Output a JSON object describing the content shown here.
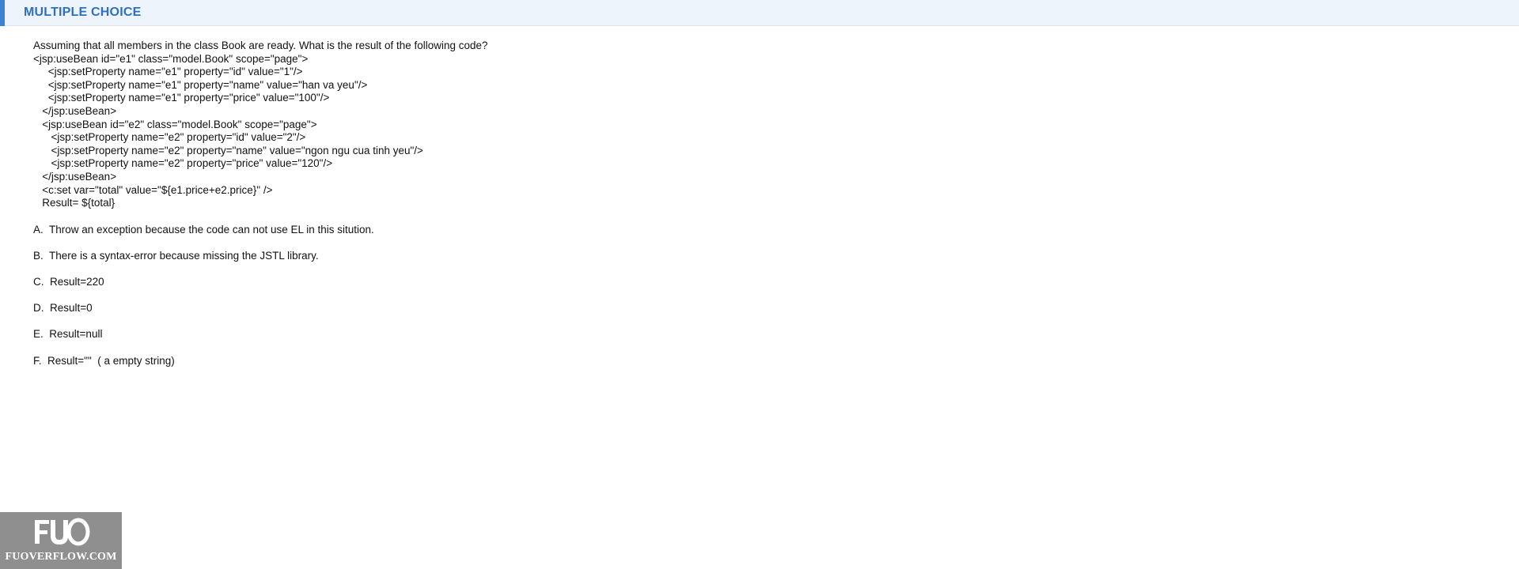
{
  "header": {
    "title": "MULTIPLE CHOICE"
  },
  "question": {
    "lines": [
      "Assuming that all members in the class Book are ready. What is the result of the following code?",
      "<jsp:useBean id=\"e1\" class=\"model.Book\" scope=\"page\">",
      "     <jsp:setProperty name=\"e1\" property=\"id\" value=\"1\"/>",
      "     <jsp:setProperty name=\"e1\" property=\"name\" value=\"han va yeu\"/>",
      "     <jsp:setProperty name=\"e1\" property=\"price\" value=\"100\"/>",
      "   </jsp:useBean>",
      "   <jsp:useBean id=\"e2\" class=\"model.Book\" scope=\"page\">",
      "      <jsp:setProperty name=\"e2\" property=\"id\" value=\"2\"/>",
      "      <jsp:setProperty name=\"e2\" property=\"name\" value=\"ngon ngu cua tinh yeu\"/>",
      "      <jsp:setProperty name=\"e2\" property=\"price\" value=\"120\"/>",
      "   </jsp:useBean>",
      "   <c:set var=\"total\" value=\"${e1.price+e2.price}\" />",
      "   Result= ${total}"
    ]
  },
  "options": [
    {
      "letter": "A.",
      "text": "Throw an exception because the code can not use EL in this sitution."
    },
    {
      "letter": "B.",
      "text": "There is a syntax-error because missing the JSTL library."
    },
    {
      "letter": "C.",
      "text": "Result=220"
    },
    {
      "letter": "D.",
      "text": "Result=0"
    },
    {
      "letter": "E.",
      "text": "Result=null"
    },
    {
      "letter": "F.",
      "text": "Result=\"\"  ( a empty string)"
    }
  ],
  "watermark": {
    "mark": "FUO",
    "text": "FUOVERFLOW.COM"
  }
}
